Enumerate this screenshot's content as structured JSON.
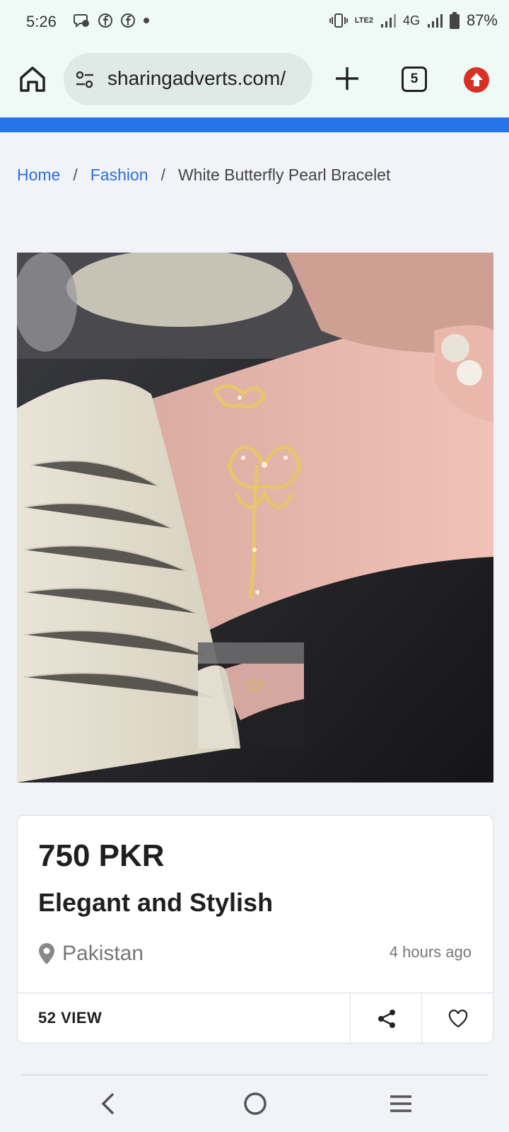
{
  "status_bar": {
    "time": "5:26",
    "network": "4G",
    "battery": "87%",
    "volte": "LTE2"
  },
  "browser": {
    "url": "sharingadverts.com/",
    "tab_count": "5"
  },
  "breadcrumb": {
    "home": "Home",
    "category": "Fashion",
    "current": "White Butterfly Pearl Bracelet",
    "separator": "/"
  },
  "listing": {
    "price": "750 PKR",
    "title": "Elegant and Stylish",
    "location": "Pakistan",
    "posted": "4 hours ago",
    "views": "52 VIEW"
  },
  "colors": {
    "accent": "#2674ea",
    "link": "#2c6fe0",
    "chrome": "#effaf7"
  }
}
